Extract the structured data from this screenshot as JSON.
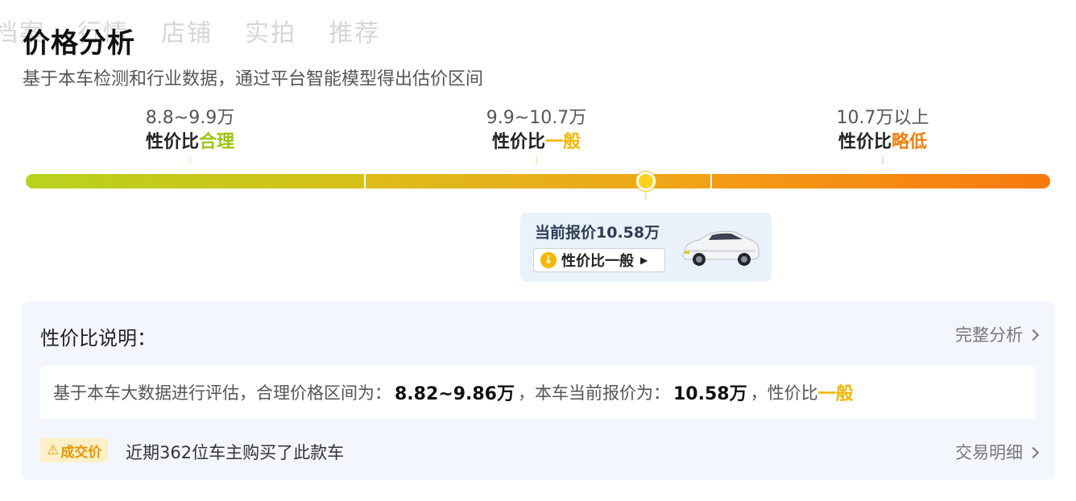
{
  "ghost_tabs": [
    "档案",
    "行情",
    "店铺",
    "实拍",
    "推荐"
  ],
  "title": "价格分析",
  "subtitle": "基于本车检测和行业数据，通过平台智能模型得出估价区间",
  "segments": [
    {
      "range": "8.8~9.9万",
      "prefix": "性价比",
      "level": "合理",
      "level_color": "#9cc413"
    },
    {
      "range": "9.9~10.7万",
      "prefix": "性价比",
      "level": "一般",
      "level_color": "#f2b600"
    },
    {
      "range": "10.7万以上",
      "prefix": "性价比",
      "level": "略低",
      "level_color": "#f07f0f"
    }
  ],
  "bar_colors": [
    "#b6d21f",
    "#f2a218",
    "#f57d12"
  ],
  "marker_position": 0.58,
  "current_price": {
    "label": "当前报价10.58万",
    "tag": "性价比一般"
  },
  "explain": {
    "title": "性价比说明：",
    "full_link": "完整分析",
    "text_a": "基于本车大数据进行评估，合理价格区间为：",
    "range": "8.82~9.86万",
    "text_b": "，本车当前报价为：",
    "price": "10.58万",
    "text_c": "，性价比",
    "level": "一般"
  },
  "deal": {
    "badge": "成交价",
    "text": "近期362位车主购买了此款车",
    "link": "交易明细"
  }
}
